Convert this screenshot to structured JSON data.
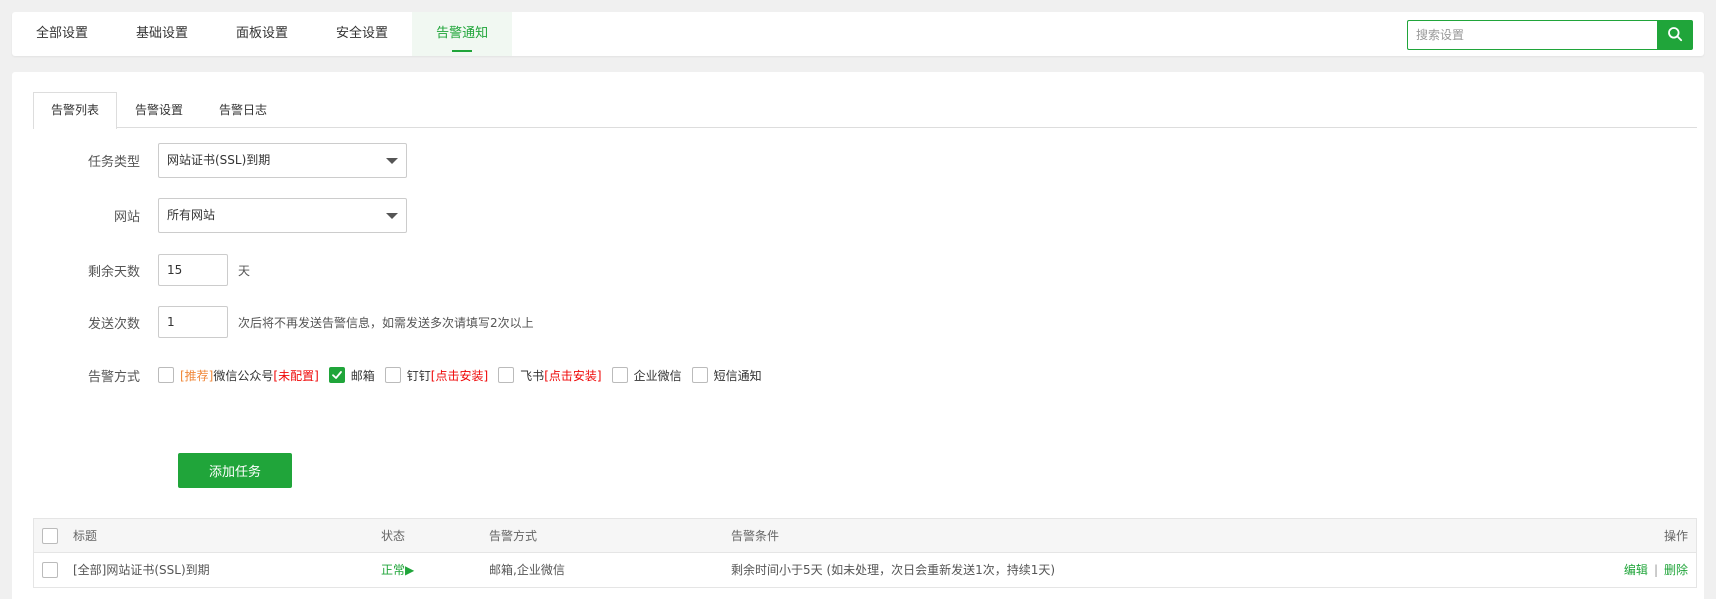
{
  "topnav": {
    "tabs": [
      {
        "label": "全部设置"
      },
      {
        "label": "基础设置"
      },
      {
        "label": "面板设置"
      },
      {
        "label": "安全设置"
      },
      {
        "label": "告警通知"
      }
    ],
    "active_index": 4,
    "search": {
      "placeholder": "搜索设置",
      "value": ""
    }
  },
  "subtabs": [
    {
      "label": "告警列表"
    },
    {
      "label": "告警设置"
    },
    {
      "label": "告警日志"
    }
  ],
  "form": {
    "task_type": {
      "label": "任务类型",
      "value": "网站证书(SSL)到期"
    },
    "site": {
      "label": "网站",
      "value": "所有网站"
    },
    "days_left": {
      "label": "剩余天数",
      "value": "15",
      "unit": "天"
    },
    "send_count": {
      "label": "发送次数",
      "value": "1",
      "hint": "次后将不再发送告警信息，如需发送多次请填写2次以上"
    },
    "alert_method": {
      "label": "告警方式",
      "options": {
        "wechat_mp": {
          "tag": "[推荐]",
          "name": "微信公众号",
          "status": "[未配置]",
          "checked": false
        },
        "email": {
          "name": "邮箱",
          "checked": true
        },
        "dingtalk": {
          "name": "钉钉",
          "status": "[点击安装]",
          "checked": false
        },
        "feishu": {
          "name": "飞书",
          "status": "[点击安装]",
          "checked": false
        },
        "wecom": {
          "name": "企业微信",
          "checked": false
        },
        "sms": {
          "name": "短信通知",
          "checked": false
        }
      }
    },
    "submit_label": "添加任务"
  },
  "table": {
    "headers": {
      "title": "标题",
      "status": "状态",
      "method": "告警方式",
      "condition": "告警条件",
      "ops": "操作"
    },
    "rows": [
      {
        "title": "[全部]网站证书(SSL)到期",
        "status": "正常▶",
        "method": "邮箱,企业微信",
        "condition": "剩余时间小于5天 (如未处理，次日会重新发送1次，持续1天)",
        "edit": "编辑",
        "sep": "|",
        "delete": "删除"
      }
    ]
  },
  "colors": {
    "accent": "#20a53a",
    "recommend": "#f0883a",
    "warning": "#ef0808"
  }
}
